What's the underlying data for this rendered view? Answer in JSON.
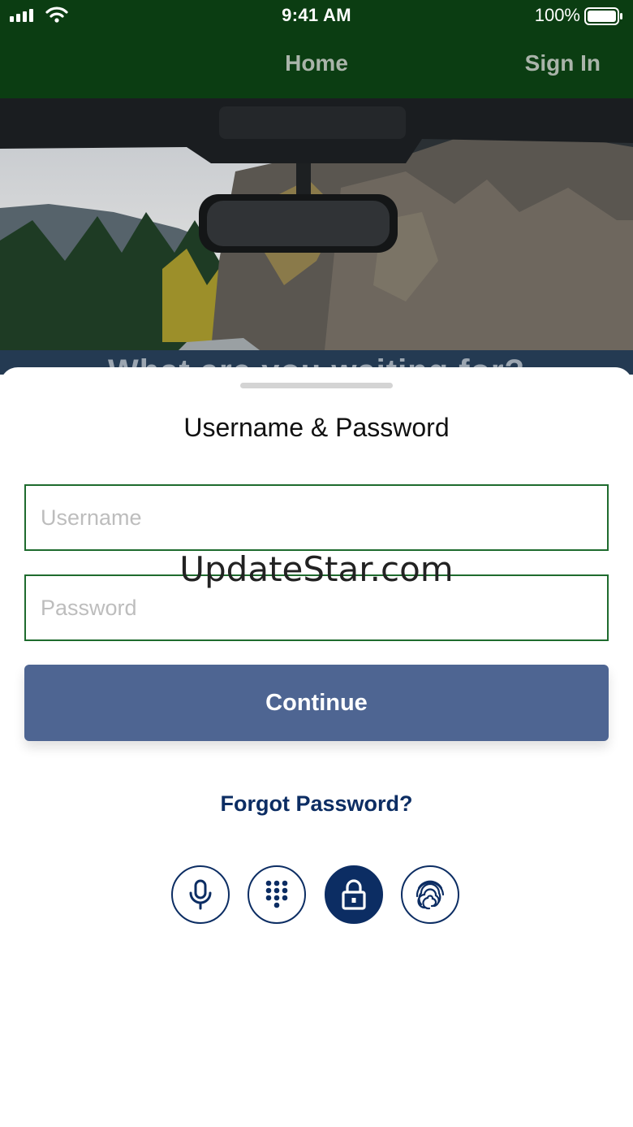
{
  "status_bar": {
    "time": "9:41 AM",
    "battery_percent": "100%"
  },
  "nav": {
    "home_label": "Home",
    "signin_label": "Sign In"
  },
  "hero": {
    "banner_text": "What are you waiting for?"
  },
  "sheet": {
    "title": "Username & Password",
    "username_placeholder": "Username",
    "username_value": "",
    "password_placeholder": "Password",
    "password_value": "",
    "watermark": "UpdateStar.com",
    "continue_label": "Continue",
    "forgot_label": "Forgot Password?",
    "auth_methods": [
      {
        "icon": "microphone-icon",
        "active": false
      },
      {
        "icon": "keypad-icon",
        "active": false
      },
      {
        "icon": "lock-icon",
        "active": true
      },
      {
        "icon": "fingerprint-icon",
        "active": false
      }
    ]
  },
  "colors": {
    "header_green": "#0b3d12",
    "field_border": "#1e6b2e",
    "button_blue": "#4e6592",
    "navy": "#0c2d63"
  }
}
